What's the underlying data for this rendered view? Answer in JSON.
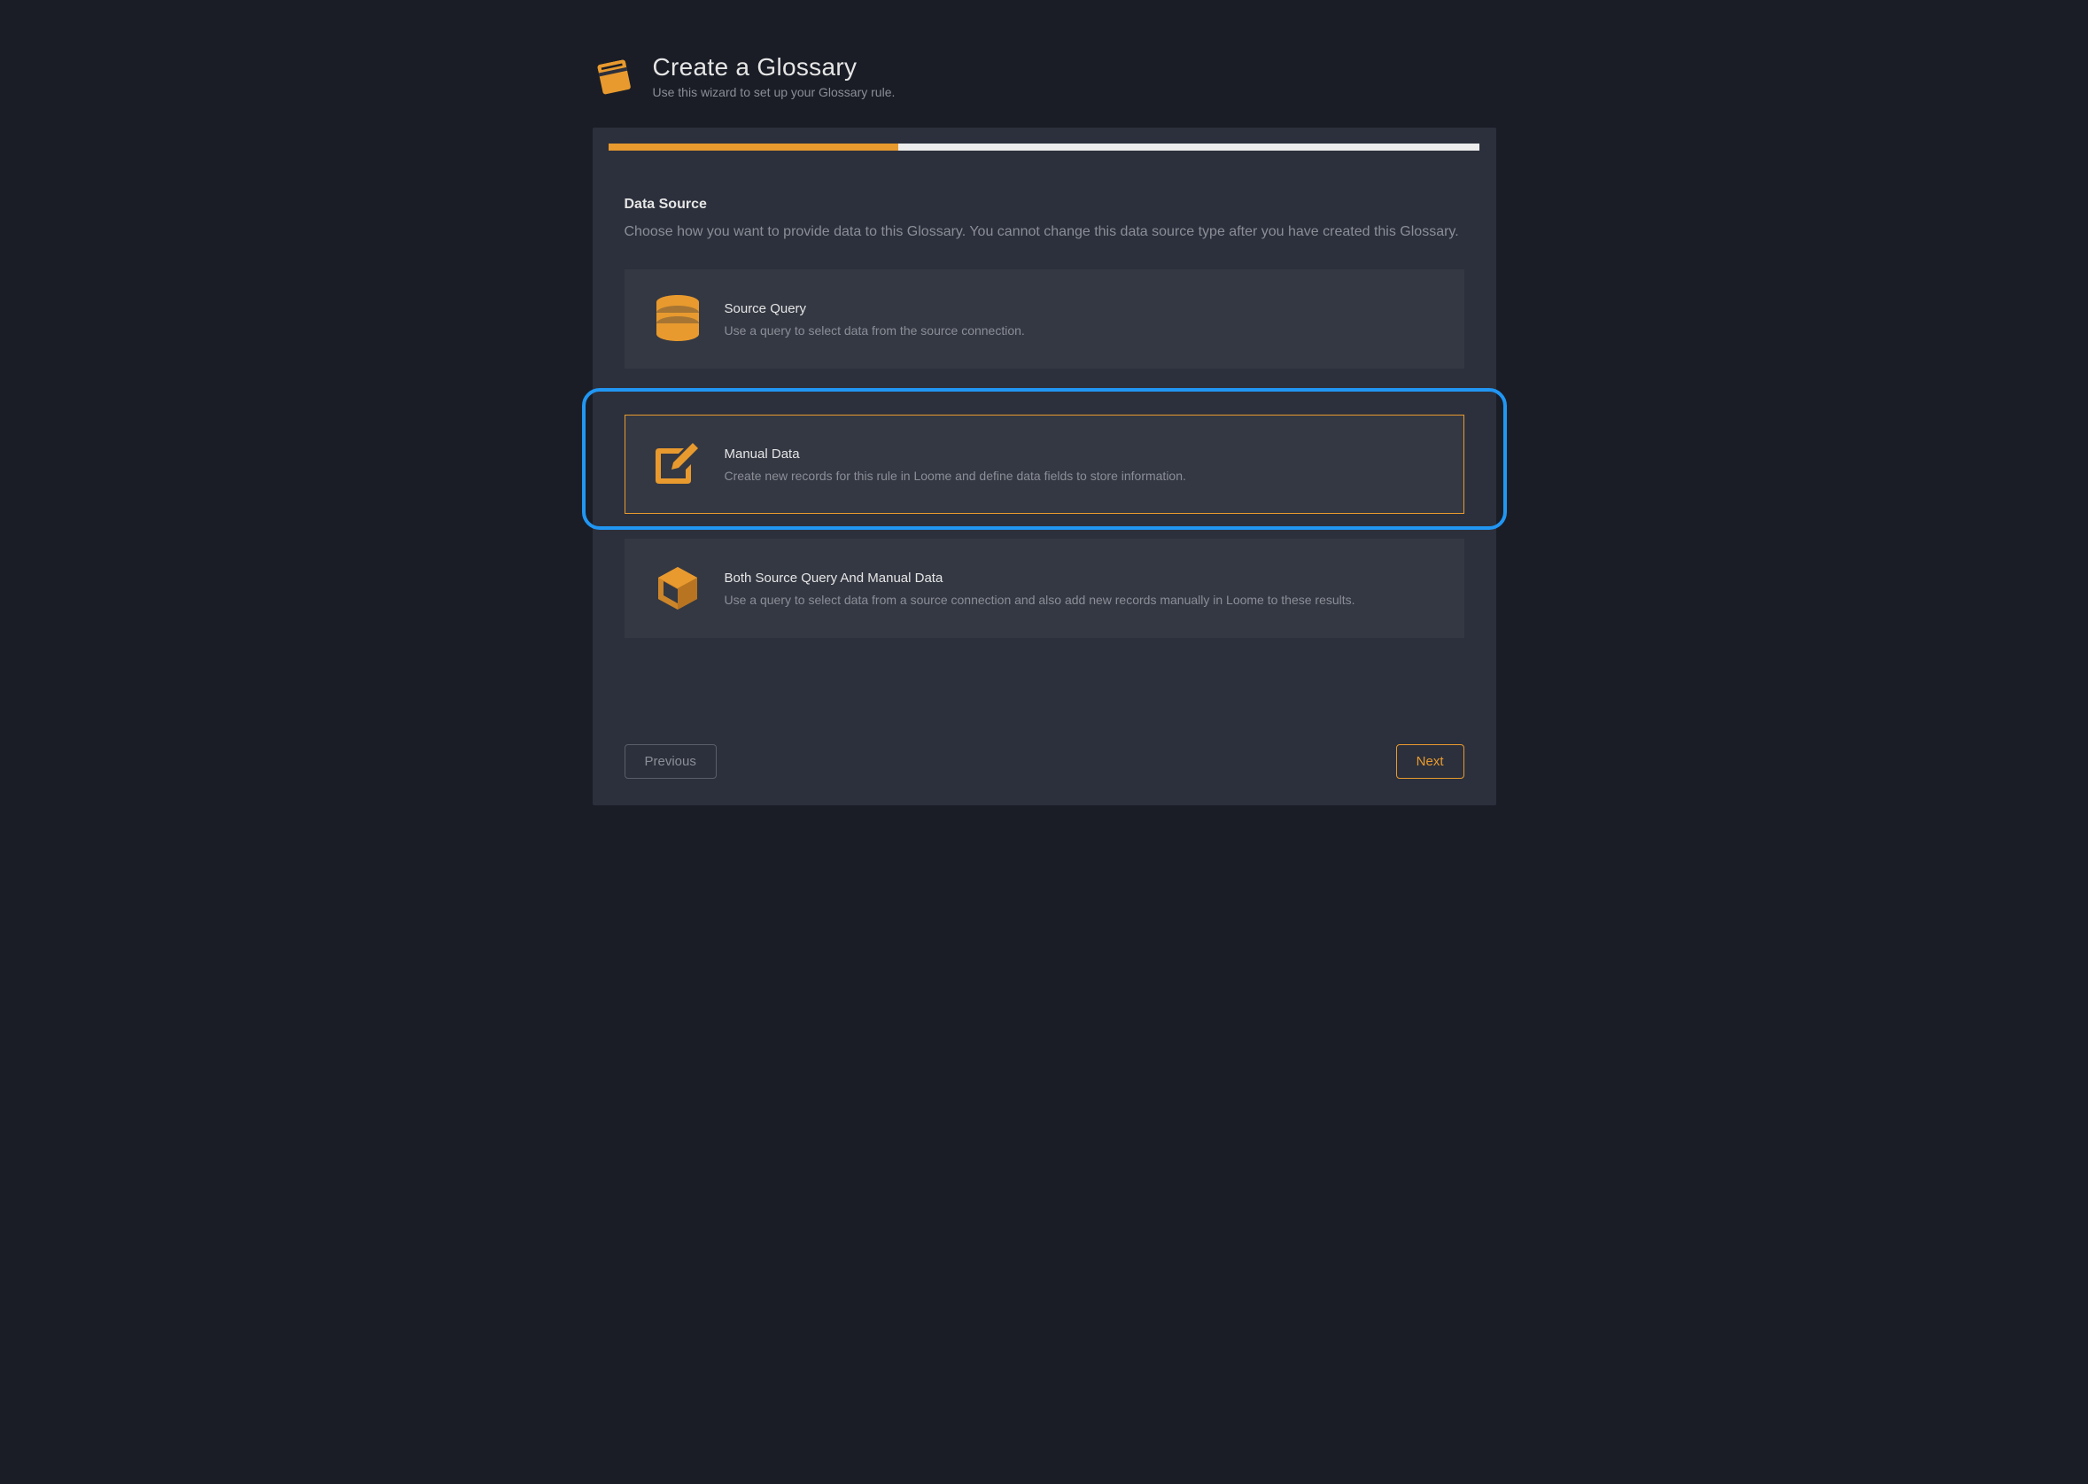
{
  "header": {
    "title": "Create a Glossary",
    "subtitle": "Use this wizard to set up your Glossary rule."
  },
  "progress": {
    "filled_percent": 33.3,
    "remaining_percent": 66.7
  },
  "section": {
    "title": "Data Source",
    "description": "Choose how you want to provide data to this Glossary. You cannot change this data source type after you have created this Glossary."
  },
  "options": [
    {
      "title": "Source Query",
      "description": "Use a query to select data from the source connection."
    },
    {
      "title": "Manual Data",
      "description": "Create new records for this rule in Loome and define data fields to store information."
    },
    {
      "title": "Both Source Query And Manual Data",
      "description": "Use a query to select data from a source connection and also add new records manually in Loome to these results."
    }
  ],
  "footer": {
    "previous_label": "Previous",
    "next_label": "Next"
  },
  "colors": {
    "accent": "#e89a2e",
    "highlight": "#2196f3",
    "background": "#1a1d26",
    "card": "#2c303c",
    "option_card": "#343843"
  }
}
